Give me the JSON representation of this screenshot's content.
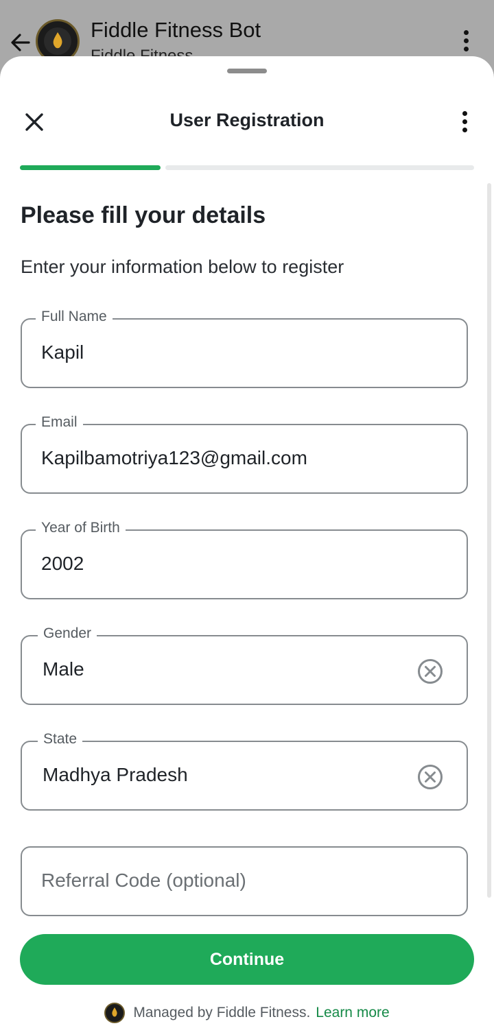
{
  "chat_header": {
    "title": "Fiddle Fitness Bot",
    "subtitle": "Fiddle Fitness"
  },
  "sheet": {
    "title": "User Registration",
    "progress_fraction": 0.31
  },
  "form": {
    "heading": "Please fill your details",
    "subheading": "Enter your information below to register",
    "fields": [
      {
        "label": "Full Name",
        "value": "Kapil"
      },
      {
        "label": "Email",
        "value": "Kapilbamotriya123@gmail.com"
      },
      {
        "label": "Year of Birth",
        "value": "2002"
      },
      {
        "label": "Gender",
        "value": "Male"
      },
      {
        "label": "State",
        "value": "Madhya Pradesh"
      },
      {
        "label": "",
        "placeholder": "Referral Code (optional)"
      }
    ]
  },
  "actions": {
    "continue_label": "Continue"
  },
  "footer": {
    "managed_by": "Managed by Fiddle Fitness.",
    "learn_more": "Learn more"
  },
  "colors": {
    "accent": "#1faa59",
    "link": "#168a48"
  }
}
